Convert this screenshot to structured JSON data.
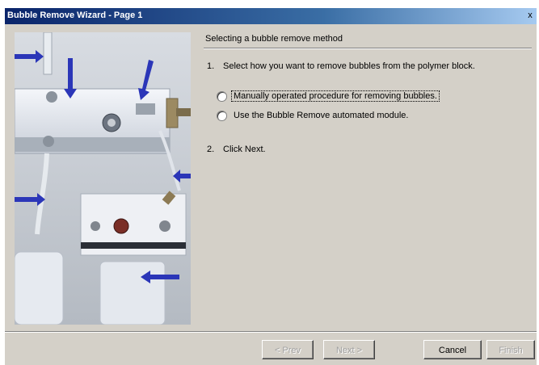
{
  "window": {
    "title": "Bubble Remove Wizard - Page 1",
    "close_glyph": "x"
  },
  "content": {
    "heading": "Selecting a bubble remove method",
    "step1_number": "1.",
    "step1_text": "Select how you want to remove bubbles from the polymer block.",
    "options": [
      {
        "label": "Manually operated procedure for removing bubbles.",
        "selected": false,
        "focused": true
      },
      {
        "label": "Use the Bubble Remove automated module.",
        "selected": false,
        "focused": false
      }
    ],
    "step2_number": "2.",
    "step2_text": "Click Next."
  },
  "buttons": {
    "prev": "< Prev",
    "next": "Next >",
    "cancel": "Cancel",
    "finish": "Finish"
  },
  "colors": {
    "title_bar_start": "#0a246a",
    "title_bar_end": "#a6caf0",
    "dialog_bg": "#d4d0c8",
    "arrow": "#2b36b8"
  }
}
